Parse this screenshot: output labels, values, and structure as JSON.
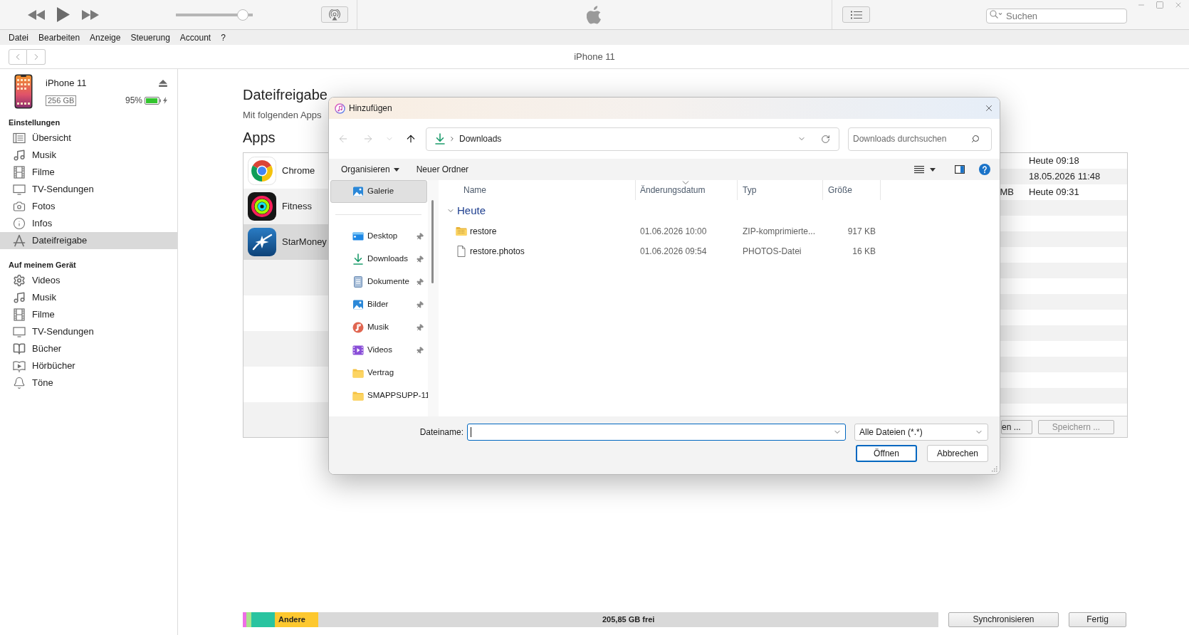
{
  "player": {
    "volume": {
      "level": 0.94
    }
  },
  "store_search": {
    "placeholder": "Suchen"
  },
  "menu_bar": [
    "Datei",
    "Bearbeiten",
    "Anzeige",
    "Steuerung",
    "Account",
    "?"
  ],
  "nav_bar": {
    "title": "iPhone 11"
  },
  "device": {
    "name": "iPhone 11",
    "capacity": "256 GB",
    "battery": {
      "reading": "95%",
      "level": 0.95,
      "charging": true
    }
  },
  "sidebar": {
    "sections": [
      {
        "heading": "Einstellungen",
        "items": [
          {
            "label": "Übersicht",
            "kind": "summary",
            "selected": false
          },
          {
            "label": "Musik",
            "kind": "music",
            "selected": false
          },
          {
            "label": "Filme",
            "kind": "movies",
            "selected": false
          },
          {
            "label": "TV-Sendungen",
            "kind": "tv",
            "selected": false
          },
          {
            "label": "Fotos",
            "kind": "photos",
            "selected": false
          },
          {
            "label": "Infos",
            "kind": "info",
            "selected": false
          },
          {
            "label": "Dateifreigabe",
            "kind": "filesharing",
            "selected": true
          }
        ]
      },
      {
        "heading": "Auf meinem Gerät",
        "items": [
          {
            "label": "Videos",
            "kind": "videos",
            "selected": false
          },
          {
            "label": "Musik",
            "kind": "music",
            "selected": false
          },
          {
            "label": "Filme",
            "kind": "movies",
            "selected": false
          },
          {
            "label": "TV-Sendungen",
            "kind": "tv",
            "selected": false
          },
          {
            "label": "Bücher",
            "kind": "books",
            "selected": false
          },
          {
            "label": "Hörbücher",
            "kind": "audiobooks",
            "selected": false
          },
          {
            "label": "Töne",
            "kind": "tones",
            "selected": false
          }
        ]
      }
    ]
  },
  "file_sharing": {
    "title": "Dateifreigabe",
    "subtitle": "Mit folgenden Apps",
    "apps_heading": "Apps",
    "apps": [
      {
        "name": "Chrome",
        "kind": "browser",
        "selected": false
      },
      {
        "name": "Fitness",
        "kind": "rings",
        "selected": false
      },
      {
        "name": "StarMoney",
        "kind": "finance",
        "selected": true
      }
    ],
    "documents": {
      "rows": [
        {
          "column_2": "Heute 09:18"
        },
        {
          "column_2": "18.05.2026 11:48"
        },
        {
          "column_1": "MB",
          "column_2": "Heute 09:31"
        }
      ],
      "buttons": [
        {
          "label": "en ...",
          "disabled": false
        },
        {
          "label": "Speichern ...",
          "disabled": true
        }
      ]
    }
  },
  "storage": {
    "segments": [
      {
        "kind": "used",
        "color": "#ee6fe6",
        "level": 0.003
      },
      {
        "kind": "used",
        "color": "#a9e38d",
        "level": 0.007
      },
      {
        "kind": "used",
        "color": "#29c4a0",
        "level": 0.034
      },
      {
        "kind": "used",
        "label": "Andere",
        "color": "#fdc82f",
        "level": 0.063
      },
      {
        "kind": "free",
        "label": "205,85 GB frei",
        "color": "#d9d9d9",
        "level": 0.893
      }
    ]
  },
  "footer_buttons": [
    "Synchronisieren",
    "Fertig"
  ],
  "dialog": {
    "title": "Hinzufügen",
    "nav_buttons": [
      {
        "kind": "back",
        "disabled": true
      },
      {
        "kind": "forward",
        "disabled": true
      },
      {
        "kind": "recent",
        "disabled": true
      },
      {
        "kind": "up",
        "disabled": false
      }
    ],
    "address": {
      "path": [
        "Downloads"
      ]
    },
    "search": {
      "placeholder": "Downloads durchsuchen"
    },
    "commands": [
      {
        "label": "Organisieren",
        "menu": true
      },
      {
        "label": "Neuer Ordner",
        "menu": false
      }
    ],
    "nav_pane": {
      "top_items": [
        {
          "label": "Galerie",
          "kind": "gallery",
          "selected": true,
          "pinned": false
        }
      ],
      "items": [
        {
          "label": "Desktop",
          "kind": "desktop",
          "selected": false,
          "pinned": true
        },
        {
          "label": "Downloads",
          "kind": "downloads",
          "selected": false,
          "pinned": true
        },
        {
          "label": "Dokumente",
          "kind": "documents",
          "selected": false,
          "pinned": true
        },
        {
          "label": "Bilder",
          "kind": "pictures",
          "selected": false,
          "pinned": true
        },
        {
          "label": "Musik",
          "kind": "music",
          "selected": false,
          "pinned": true
        },
        {
          "label": "Videos",
          "kind": "videos",
          "selected": false,
          "pinned": true
        },
        {
          "label": "Vertrag",
          "kind": "folder",
          "selected": false,
          "pinned": false
        },
        {
          "label": "SMAPPSUPP-11",
          "kind": "folder",
          "selected": false,
          "pinned": false
        }
      ]
    },
    "columns": [
      {
        "label": "Name",
        "sorted": false
      },
      {
        "label": "Änderungsdatum",
        "sorted": true
      },
      {
        "label": "Typ",
        "sorted": false
      },
      {
        "label": "Größe",
        "sorted": false
      }
    ],
    "groups": [
      {
        "label": "Heute",
        "expanded": true,
        "files": [
          {
            "name": "restore",
            "kind": "zip",
            "modified": "01.06.2026 10:00",
            "type": "ZIP-komprimierte...",
            "size": "917 KB"
          },
          {
            "name": "restore.photos",
            "kind": "file",
            "modified": "01.06.2026 09:54",
            "type": "PHOTOS-Datei",
            "size": "16 KB"
          }
        ]
      }
    ],
    "filename": {
      "label": "Dateiname:",
      "focused": true
    },
    "filter": {
      "value": "Alle Dateien (*.*)"
    },
    "buttons": [
      {
        "label": "Öffnen",
        "default": true
      },
      {
        "label": "Abbrechen",
        "default": false
      }
    ]
  }
}
